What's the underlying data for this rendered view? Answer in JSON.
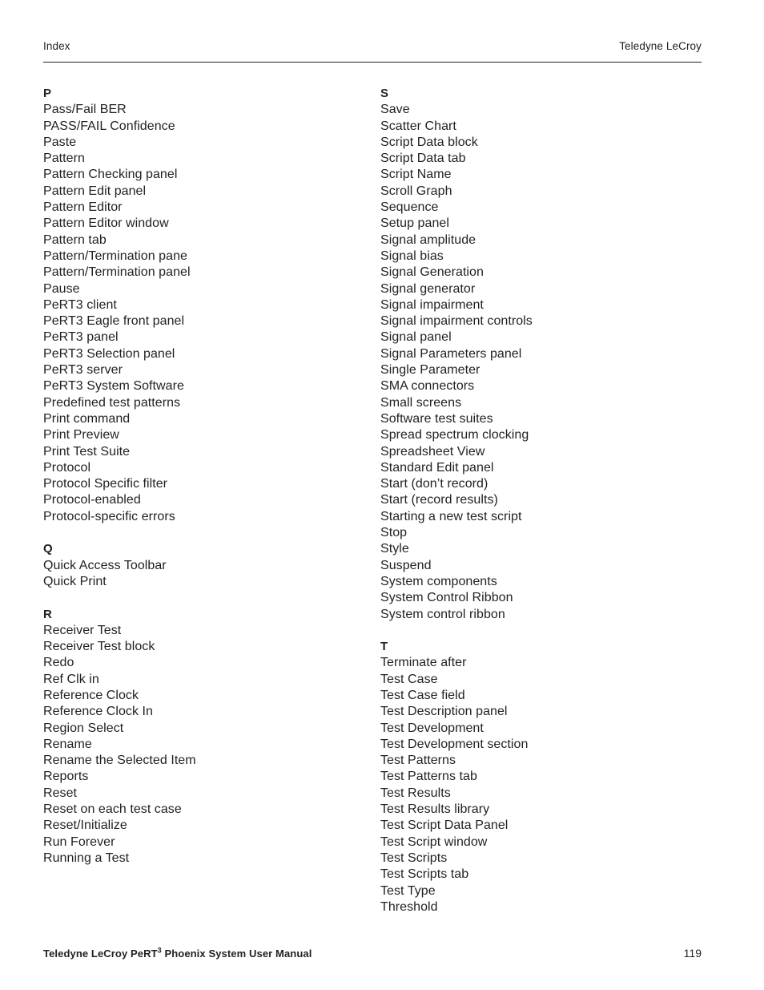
{
  "header": {
    "left": "Index",
    "right": "Teledyne LeCroy"
  },
  "footer": {
    "title_prefix": "Teledyne LeCroy PeRT",
    "title_superscript": "3",
    "title_suffix": " Phoenix System User Manual",
    "page_number": "119"
  },
  "index": {
    "columns": [
      {
        "groups": [
          {
            "letter": "P",
            "entries": [
              "Pass/Fail BER",
              "PASS/FAIL Confidence",
              "Paste",
              "Pattern",
              "Pattern Checking panel",
              "Pattern Edit panel",
              "Pattern Editor",
              "Pattern Editor window",
              "Pattern tab",
              "Pattern/Termination pane",
              "Pattern/Termination panel",
              "Pause",
              "PeRT3 client",
              "PeRT3 Eagle front panel",
              "PeRT3 panel",
              "PeRT3 Selection panel",
              "PeRT3 server",
              "PeRT3 System Software",
              "Predefined test patterns",
              "Print command",
              "Print Preview",
              "Print Test Suite",
              "Protocol",
              "Protocol Specific filter",
              "Protocol-enabled",
              "Protocol-specific errors"
            ]
          },
          {
            "letter": "Q",
            "entries": [
              "Quick Access Toolbar",
              "Quick Print"
            ]
          },
          {
            "letter": "R",
            "entries": [
              "Receiver Test",
              "Receiver Test block",
              "Redo",
              "Ref Clk in",
              "Reference Clock",
              "Reference Clock In",
              "Region Select",
              "Rename",
              "Rename the Selected Item",
              "Reports",
              "Reset",
              "Reset on each test case",
              "Reset/Initialize",
              "Run Forever",
              "Running a Test"
            ]
          }
        ]
      },
      {
        "groups": [
          {
            "letter": "S",
            "entries": [
              "Save",
              "Scatter Chart",
              "Script Data block",
              "Script Data tab",
              "Script Name",
              "Scroll Graph",
              "Sequence",
              "Setup panel",
              "Signal amplitude",
              "Signal bias",
              "Signal Generation",
              "Signal generator",
              "Signal impairment",
              "Signal impairment controls",
              "Signal panel",
              "Signal Parameters panel",
              "Single Parameter",
              "SMA connectors",
              "Small screens",
              "Software test suites",
              "Spread spectrum clocking",
              "Spreadsheet View",
              "Standard Edit panel",
              "Start (don’t record)",
              "Start (record results)",
              "Starting a new test script",
              "Stop",
              "Style",
              "Suspend",
              "System components",
              "System Control Ribbon",
              "System control ribbon"
            ]
          },
          {
            "letter": "T",
            "entries": [
              "Terminate after",
              "Test Case",
              "Test Case field",
              "Test Description panel",
              "Test Development",
              "Test Development section",
              "Test Patterns",
              "Test Patterns tab",
              "Test Results",
              "Test Results library",
              "Test Script Data Panel",
              "Test Script window",
              "Test Scripts",
              "Test Scripts tab",
              "Test Type",
              "Threshold"
            ]
          }
        ]
      }
    ]
  }
}
